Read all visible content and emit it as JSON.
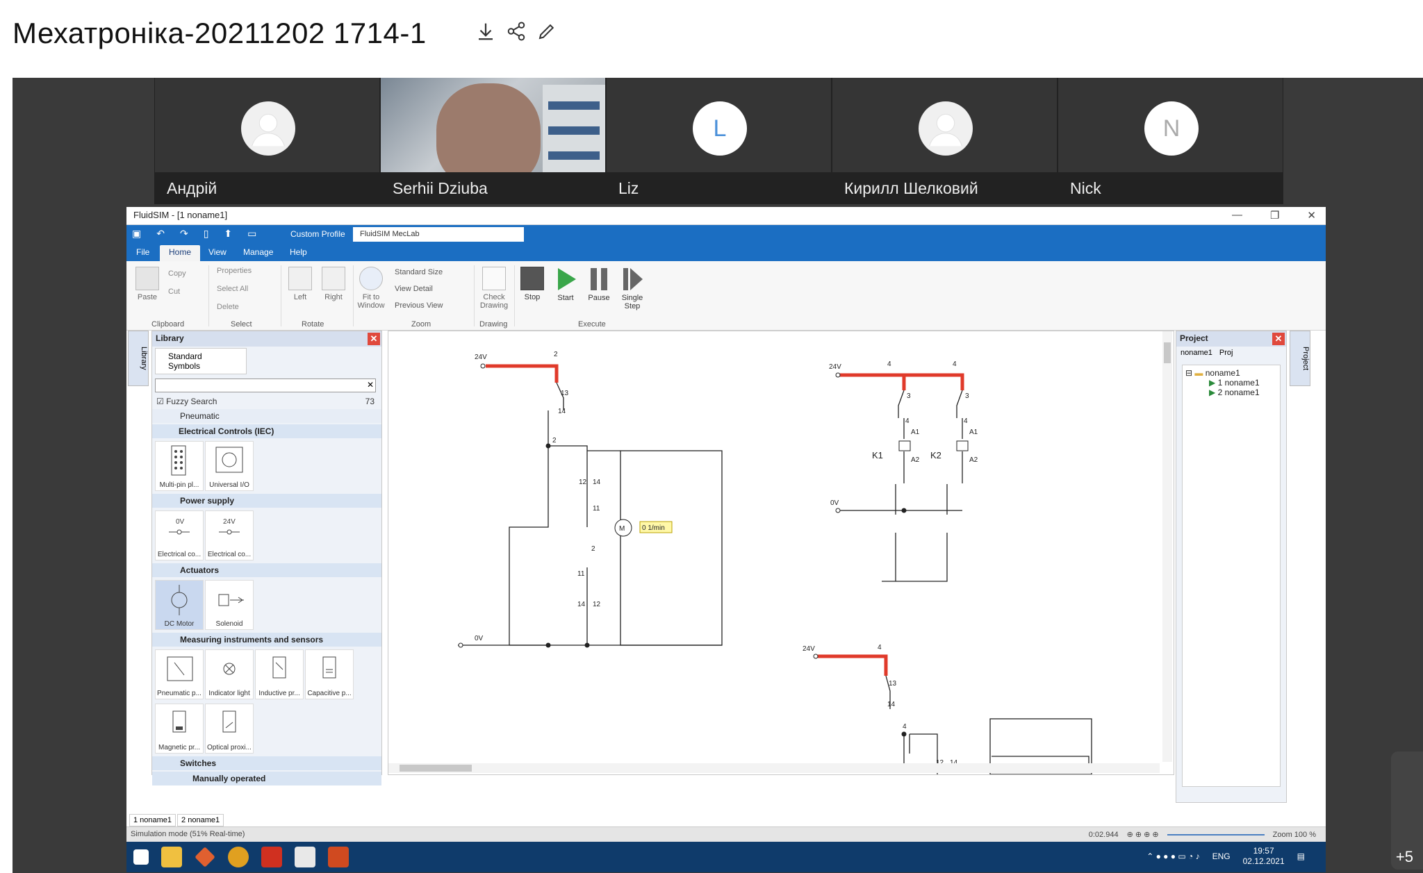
{
  "page_title": "Мехатроніка-20211202 1714-1",
  "participants": [
    {
      "name": "Андрій",
      "initial": ""
    },
    {
      "name": "Serhii Dziuba",
      "initial": ""
    },
    {
      "name": "Liz",
      "initial": "L"
    },
    {
      "name": "Кирилл Шелковий",
      "initial": ""
    },
    {
      "name": "Nick",
      "initial": "N"
    }
  ],
  "more_count": "+5",
  "app": {
    "window_title": "FluidSIM - [1  noname1]",
    "custom_profile_label": "Custom Profile",
    "profile_value": "FluidSIM MecLab",
    "menu": [
      "File",
      "Home",
      "View",
      "Manage",
      "Help"
    ],
    "ribbon": {
      "clipboard": {
        "paste": "Paste",
        "copy": "Copy",
        "cut": "Cut",
        "group": "Clipboard"
      },
      "select": {
        "properties": "Properties",
        "select_all": "Select All",
        "delete": "Delete",
        "group": "Select"
      },
      "rotate": {
        "left": "Left",
        "right": "Right",
        "group": "Rotate"
      },
      "zoom": {
        "fit": "Fit to Window",
        "standard": "Standard Size",
        "detail": "View Detail",
        "previous": "Previous View",
        "group": "Zoom"
      },
      "drawing": {
        "check": "Check Drawing",
        "group": "Drawing"
      },
      "execute": {
        "stop": "Stop",
        "start": "Start",
        "pause": "Pause",
        "single": "Single Step",
        "group": "Execute"
      }
    },
    "library": {
      "title": "Library",
      "side_tab": "Library",
      "tab": "Standard Symbols",
      "fuzzy": "Fuzzy Search",
      "count": "73",
      "pneumatic": "Pneumatic",
      "categories": [
        {
          "name": "Electrical Controls (IEC)",
          "items": [
            "Multi-pin pl...",
            "Universal I/O"
          ]
        },
        {
          "name": "Power supply",
          "items": [
            "Electrical co...",
            "Electrical co..."
          ]
        },
        {
          "name": "Actuators",
          "items": [
            "DC Motor",
            "Solenoid"
          ]
        },
        {
          "name": "Measuring instruments and sensors",
          "items": [
            "Pneumatic p...",
            "Indicator light",
            "Inductive pr...",
            "Capacitive p...",
            "Magnetic pr...",
            "Optical proxi..."
          ]
        },
        {
          "name": "Switches",
          "items": []
        },
        {
          "name": "Manually operated",
          "items": []
        }
      ],
      "power_labels": [
        "0V",
        "24V"
      ]
    },
    "project": {
      "title": "Project",
      "side_tab": "Project",
      "tab1": "noname1",
      "tab2": "Proj",
      "tree_root": "noname1",
      "tree_items": [
        "1  noname1",
        "2  noname1"
      ]
    },
    "circuit": {
      "v24": "24V",
      "v0": "0V",
      "motor_label": "M",
      "motor_value": "0 1/min",
      "k1": "K1",
      "k2": "K2",
      "nodes": [
        "2",
        "13",
        "14",
        "2",
        "12",
        "14",
        "11",
        "2",
        "11",
        "14",
        "12",
        "4",
        "4",
        "3",
        "3",
        "4",
        "4",
        "A1",
        "A1",
        "A2",
        "A2",
        "4",
        "13",
        "14",
        "4",
        "12",
        "14"
      ]
    },
    "bottom_tabs": [
      "1 noname1",
      "2 noname1"
    ],
    "status": {
      "mode": "Simulation mode (51% Real-time)",
      "time": "0:02.944",
      "zoom": "Zoom 100 %"
    },
    "taskbar": {
      "lang": "ENG",
      "time": "19:57",
      "date": "02.12.2021"
    }
  }
}
